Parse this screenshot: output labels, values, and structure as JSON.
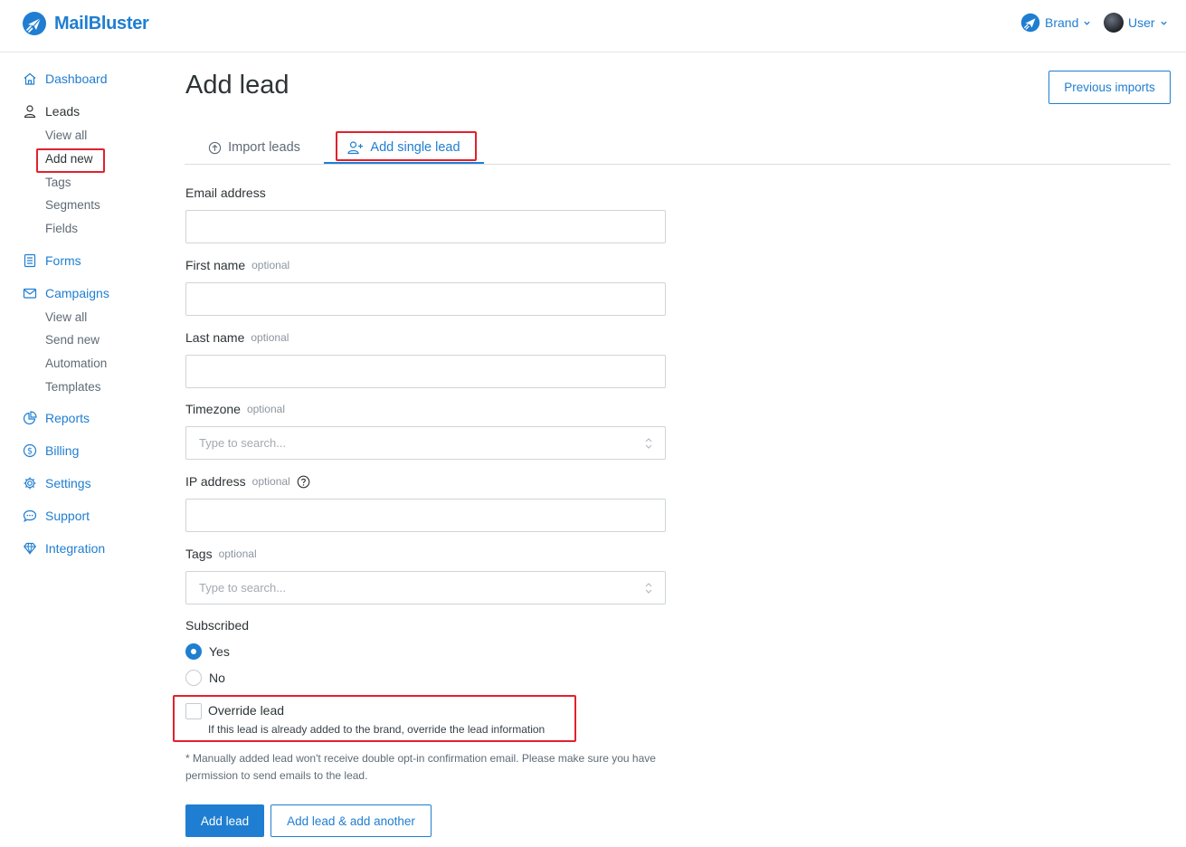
{
  "header": {
    "app_name": "MailBluster",
    "brand_label": "Brand",
    "user_label": "User"
  },
  "sidebar": {
    "dashboard": "Dashboard",
    "leads": "Leads",
    "leads_sub": [
      "View all",
      "Add new",
      "Tags",
      "Segments",
      "Fields"
    ],
    "forms": "Forms",
    "campaigns": "Campaigns",
    "campaigns_sub": [
      "View all",
      "Send new",
      "Automation",
      "Templates"
    ],
    "reports": "Reports",
    "billing": "Billing",
    "settings": "Settings",
    "support": "Support",
    "integration": "Integration"
  },
  "main": {
    "title": "Add lead",
    "previous_imports": "Previous imports",
    "tabs": [
      {
        "label": "Import leads",
        "icon": "upload-circle-icon",
        "active": false
      },
      {
        "label": "Add single lead",
        "icon": "user-plus-icon",
        "active": true
      }
    ],
    "form": {
      "email_label": "Email address",
      "first_name_label": "First name",
      "last_name_label": "Last name",
      "timezone_label": "Timezone",
      "timezone_placeholder": "Type to search...",
      "ip_label": "IP address",
      "tags_label": "Tags",
      "tags_placeholder": "Type to search...",
      "optional_text": "optional",
      "subscribed_label": "Subscribed",
      "subscribed_options": [
        {
          "label": "Yes",
          "checked": true
        },
        {
          "label": "No",
          "checked": false
        }
      ],
      "override_label": "Override lead",
      "override_help": "If this lead is already added to the brand, override the lead information",
      "override_checked": false,
      "note": "* Manually added lead won't receive double opt-in confirmation email. Please make sure you have permission to send emails to the lead."
    },
    "buttons": {
      "add_lead": "Add lead",
      "add_another": "Add lead & add another"
    }
  },
  "colors": {
    "accent": "#1f7ed1",
    "highlight": "#e0212f"
  }
}
